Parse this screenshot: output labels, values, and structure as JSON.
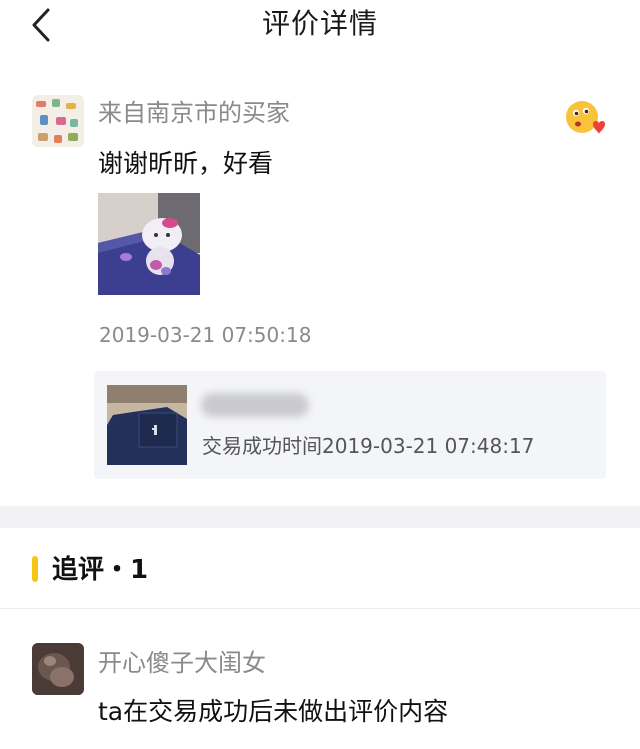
{
  "header": {
    "title": "评价详情",
    "back_icon": "chevron-left-icon"
  },
  "review": {
    "reviewer_name": "来自南京市的买家",
    "emoji_icon": "kiss-emoji-icon",
    "text": "谢谢昕昕，好看",
    "timestamp": "2019-03-21 07:50:18"
  },
  "order": {
    "status_text": "交易成功时间2019-03-21 07:48:17"
  },
  "followup": {
    "section_title": "追评・1",
    "accent_color": "#f5c518",
    "reviewer_name": "开心傻子大闺女",
    "text": "ta在交易成功后未做出评价内容"
  }
}
